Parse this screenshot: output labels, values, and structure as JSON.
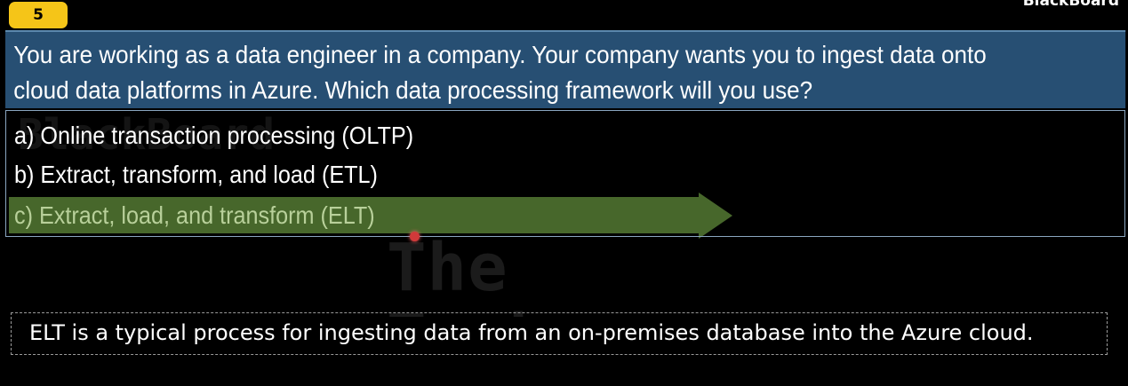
{
  "question_number": "5",
  "brand_text": "BlackBoard",
  "watermark": {
    "line1": "The Tech",
    "line2": "BlackBoard"
  },
  "question": {
    "line1": "You are working as a data engineer in a company. Your company wants you to ingest data onto",
    "line2": "cloud data platforms in Azure. Which data processing framework will you use?"
  },
  "options": [
    {
      "label": "a) Online transaction processing (OLTP)"
    },
    {
      "label": "b) Extract, transform, and load (ETL)"
    },
    {
      "label": "c) Extract, load, and transform (ELT)",
      "selected": true
    }
  ],
  "answer_note": "ELT is a typical process for ingesting data from an on-premises database into the Azure cloud.",
  "colors": {
    "badge": "#f5c518",
    "question_bg": "#274f73",
    "highlight_arrow": "#47672b",
    "selected_text": "#b8d09a",
    "cursor": "#d13a3a"
  }
}
